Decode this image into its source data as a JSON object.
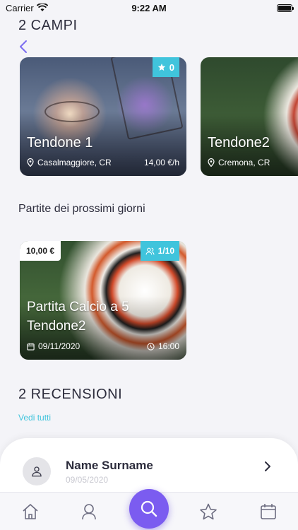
{
  "status_bar": {
    "carrier": "Carrier",
    "time": "9:22 AM"
  },
  "courts_section": {
    "title": "2 CAMPI"
  },
  "courts": [
    {
      "name": "Tendone 1",
      "rating": "0",
      "location": "Casalmaggiore, CR",
      "price": "14,00 €/h"
    },
    {
      "name": "Tendone2",
      "location": "Cremona, CR"
    }
  ],
  "upcoming": {
    "heading": "Partite dei prossimi giorni",
    "match": {
      "price": "10,00 €",
      "players": "1/10",
      "title": "Partita Calcio a 5 Tendone2",
      "date": "09/11/2020",
      "time": "16:00"
    }
  },
  "reviews_section": {
    "title": "2 RECENSIONI",
    "see_all": "Vedi tutti"
  },
  "review": {
    "author": "Name Surname",
    "date": "09/05/2020"
  },
  "tab_bar": {
    "tabs": [
      "home-icon",
      "profile-icon",
      "search-icon",
      "star-icon",
      "calendar-icon"
    ],
    "fab_color": "#7b5cf0",
    "accent_color": "#40c4dc"
  }
}
